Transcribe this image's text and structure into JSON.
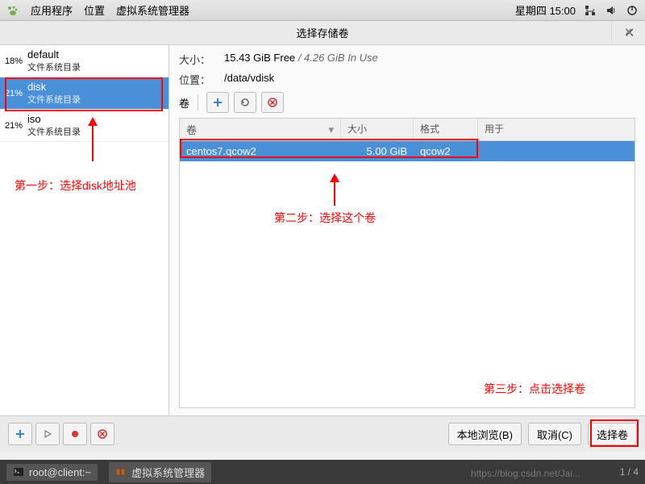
{
  "topbar": {
    "apps": "应用程序",
    "places": "位置",
    "vmm": "虚拟系统管理器",
    "clock": "星期四 15:00"
  },
  "dialog": {
    "title": "选择存储卷",
    "size_label": "大小：",
    "size_free": "15.43 GiB Free",
    "size_sep": " / ",
    "size_used": "4.26 GiB In Use",
    "loc_label": "位置：",
    "loc_value": "/data/vdisk",
    "vol_label": "卷",
    "columns": {
      "c1": "卷",
      "c2": "大小",
      "c3": "格式",
      "c4": "用于"
    },
    "row": {
      "name": "centos7.qcow2",
      "size": "5.00 GiB",
      "fmt": "qcow2",
      "used": ""
    },
    "buttons": {
      "browse": "本地浏览(B)",
      "cancel": "取消(C)",
      "choose": "选择卷"
    }
  },
  "pools": [
    {
      "pct": "18%",
      "name": "default",
      "sub": "文件系统目录"
    },
    {
      "pct": "21%",
      "name": "disk",
      "sub": "文件系统目录"
    },
    {
      "pct": "21%",
      "name": "iso",
      "sub": "文件系统目录"
    }
  ],
  "annotations": {
    "step1": "第一步：选择disk地址池",
    "step2": "第二步：选择这个卷",
    "step3": "第三步：点击选择卷"
  },
  "taskbar": {
    "term": "root@client:~",
    "vmm": "虚拟系统管理器",
    "pager": "1 / 4"
  },
  "watermark": "https://blog.csdn.net/Jai..."
}
